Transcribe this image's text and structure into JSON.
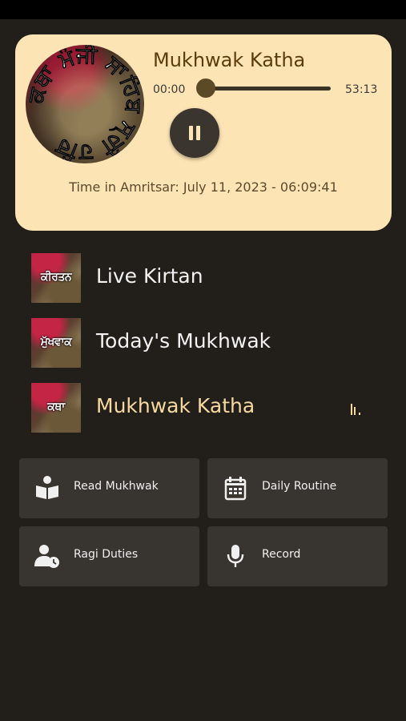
{
  "player": {
    "title": "Mukhwak Katha",
    "current_time": "00:00",
    "total_time": "53:13",
    "progress": 0.0,
    "status": "playing",
    "album_text": "ਕਥਾ ਮੰਜੀ ਸਾਹਿਬ ਸ੍ਰੀ ਹਰਿ",
    "amritsar_time": "Time in Amritsar: July 11, 2023 - 06:09:41"
  },
  "tracks": [
    {
      "thumb_text": "ਕੀਰਤਨ",
      "name": "Live Kirtan",
      "active": false
    },
    {
      "thumb_text": "ਮੁੱਖਵਾਕ",
      "name": "Today's Mukhwak",
      "active": false
    },
    {
      "thumb_text": "ਕਥਾ",
      "name": "Mukhwak Katha",
      "active": true
    }
  ],
  "actions": [
    {
      "label": "Read Mukhwak",
      "icon": "book-reader-icon"
    },
    {
      "label": "Daily Routine",
      "icon": "calendar-icon"
    },
    {
      "label": "Ragi Duties",
      "icon": "user-clock-icon"
    },
    {
      "label": "Record",
      "icon": "microphone-icon"
    }
  ],
  "colors": {
    "background": "#221f1b",
    "card": "#fde4b4",
    "accent_text": "#f7d9a0",
    "tile": "#383430"
  }
}
